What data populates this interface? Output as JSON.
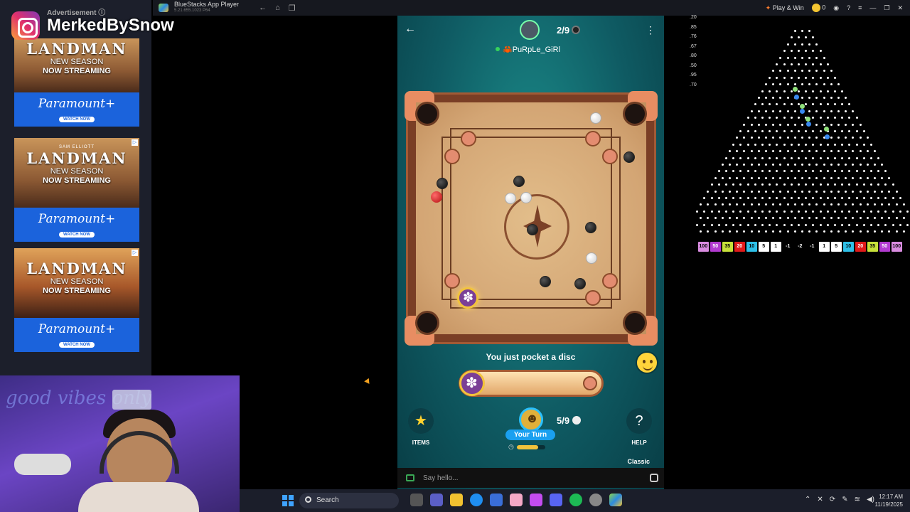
{
  "titlebar": {
    "app_name": "BlueStacks App Player",
    "version": "5.21.655.1023 P64",
    "play_win_label": "Play & Win",
    "coins": "0"
  },
  "ads": {
    "label": "Advertisement ⓘ",
    "items": [
      {
        "kicker": "",
        "title": "LANDMAN",
        "line1": "NEW SEASON",
        "line2": "NOW STREAMING",
        "brand": "Paramount+",
        "cta": "WATCH NOW"
      },
      {
        "kicker": "SAM ELLIOTT",
        "title": "LANDMAN",
        "line1": "NEW SEASON",
        "line2": "NOW STREAMING",
        "brand": "Paramount+",
        "cta": "WATCH NOW"
      },
      {
        "kicker": "",
        "title": "LANDMAN",
        "line1": "NEW SEASON",
        "line2": "NOW STREAMING",
        "brand": "Paramount+",
        "cta": "WATCH NOW"
      }
    ]
  },
  "overlay": {
    "instagram_handle": "MerkedBySnow"
  },
  "webcam": {
    "neon_text": "good vibes only"
  },
  "game": {
    "opponent_score": "2/9",
    "opponent_name": "🦀PuRpLe_GiRl",
    "notice": "You just pocket a disc",
    "items_label": "ITEMS",
    "help_label": "HELP",
    "help_glyph": "?",
    "turn_label": "Your Turn",
    "player_score": "5/9",
    "mode": "Classic",
    "timer_level": 0.75
  },
  "chat": {
    "placeholder": "Say hello..."
  },
  "plinko": {
    "multipliers": [
      ".20",
      ".85",
      ".76",
      ".67",
      ".80",
      ".50",
      ".95",
      ".70"
    ],
    "buckets": [
      {
        "label": "100",
        "color": "#d98ce0"
      },
      {
        "label": "50",
        "color": "#b23ad0"
      },
      {
        "label": "35",
        "color": "#c7e03a"
      },
      {
        "label": "20",
        "color": "#e01a1a"
      },
      {
        "label": "10",
        "color": "#2ec0e8"
      },
      {
        "label": "5",
        "color": "#ffffff"
      },
      {
        "label": "1",
        "color": "#ffffff"
      },
      {
        "label": "-1",
        "color": "#000000"
      },
      {
        "label": "-2",
        "color": "#000000"
      },
      {
        "label": "-1",
        "color": "#000000"
      },
      {
        "label": "1",
        "color": "#ffffff"
      },
      {
        "label": "5",
        "color": "#ffffff"
      },
      {
        "label": "10",
        "color": "#2ec0e8"
      },
      {
        "label": "20",
        "color": "#e01a1a"
      },
      {
        "label": "35",
        "color": "#c7e03a"
      },
      {
        "label": "50",
        "color": "#b23ad0"
      },
      {
        "label": "100",
        "color": "#d98ce0"
      }
    ]
  },
  "taskbar": {
    "search_label": "Search",
    "time": "12:17 AM",
    "date": "11/19/2025"
  }
}
